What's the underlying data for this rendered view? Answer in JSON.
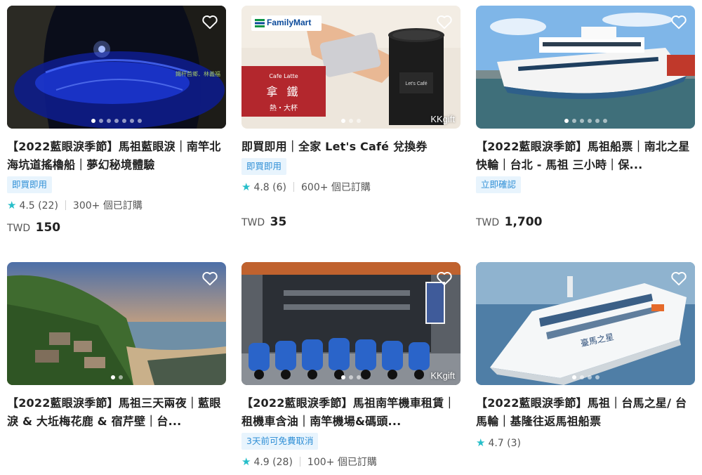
{
  "cards": [
    {
      "title": "【2022藍眼淚季節】馬祖藍眼淚｜南竿北海坑道搖櫓船｜夢幻秘境體驗",
      "badge": "即買即用",
      "rating": "4.5",
      "reviews": "(22)",
      "booked": "300+ 個已訂購",
      "currency": "TWD",
      "price": "150",
      "image_caption": "鐵杆首鄉．林義福"
    },
    {
      "title": "即買即用｜全家 Let's Café 兌換券",
      "badge": "即買即用",
      "rating": "4.8",
      "reviews": "(6)",
      "booked": "600+ 個已訂購",
      "currency": "TWD",
      "price": "35",
      "brand_logo": "FamilyMart",
      "latte_line1": "Cafe Latte",
      "latte_line2": "拿 鐵",
      "latte_line3": "熱・大杯",
      "watermark": "KKgift"
    },
    {
      "title": "【2022藍眼淚季節】馬祖船票｜南北之星快輪｜台北 - 馬祖 三小時｜保...",
      "badge": "立即確認",
      "currency": "TWD",
      "price": "1,700"
    },
    {
      "title": "【2022藍眼淚季節】馬祖三天兩夜｜藍眼淚 & 大坵梅花鹿 & 宿芹壁｜台..."
    },
    {
      "title": "【2022藍眼淚季節】馬祖南竿機車租賃｜租機車含油｜南竿機場&碼頭...",
      "badge": "3天前可免費取消",
      "rating": "4.9",
      "reviews": "(28)",
      "booked": "100+ 個已訂購",
      "watermark": "KKgift"
    },
    {
      "title": "【2022藍眼淚季節】馬祖｜台馬之星/ 台馬輪｜基隆往返馬祖船票",
      "rating": "4.7",
      "reviews": "(3)"
    }
  ],
  "icons": {
    "favorite": "heart-outline-icon",
    "rating": "star-icon"
  },
  "colors": {
    "badge_bg": "#e8f4fd",
    "badge_text": "#2f8fd6",
    "star": "#26bec9"
  }
}
